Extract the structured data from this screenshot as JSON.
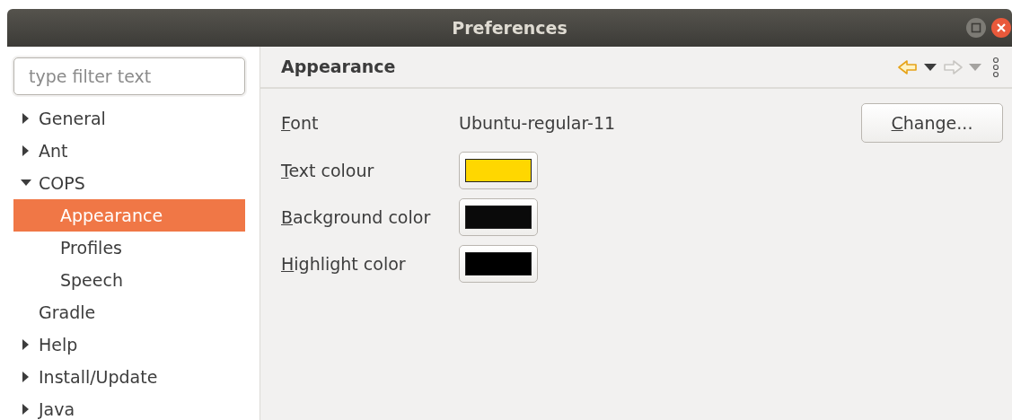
{
  "window": {
    "title": "Preferences"
  },
  "filter": {
    "placeholder": "type filter text"
  },
  "tree": [
    {
      "label": "General",
      "kind": "folder",
      "expanded": false,
      "selected": false
    },
    {
      "label": "Ant",
      "kind": "folder",
      "expanded": false,
      "selected": false
    },
    {
      "label": "COPS",
      "kind": "folder",
      "expanded": true,
      "selected": false,
      "children": [
        {
          "label": "Appearance",
          "kind": "leaf",
          "selected": true
        },
        {
          "label": "Profiles",
          "kind": "leaf",
          "selected": false
        },
        {
          "label": "Speech",
          "kind": "leaf",
          "selected": false
        }
      ]
    },
    {
      "label": "Gradle",
      "kind": "leaf",
      "selected": false
    },
    {
      "label": "Help",
      "kind": "folder",
      "expanded": false,
      "selected": false
    },
    {
      "label": "Install/Update",
      "kind": "folder",
      "expanded": false,
      "selected": false
    },
    {
      "label": "Java",
      "kind": "folder",
      "expanded": false,
      "selected": false
    }
  ],
  "page": {
    "title": "Appearance",
    "back_enabled": true,
    "forward_enabled": false
  },
  "fields": [
    {
      "kind": "text",
      "label": "Font",
      "mnemonic": true,
      "value": "Ubuntu-regular-11",
      "button": "Change..."
    },
    {
      "kind": "color",
      "label": "Text colour",
      "mnemonic": true,
      "color": "#ffd700"
    },
    {
      "kind": "color",
      "label": "Background color",
      "mnemonic": true,
      "color": "#0a0a0a"
    },
    {
      "kind": "color",
      "label": "Highlight color",
      "mnemonic": true,
      "color": "#000000"
    }
  ]
}
